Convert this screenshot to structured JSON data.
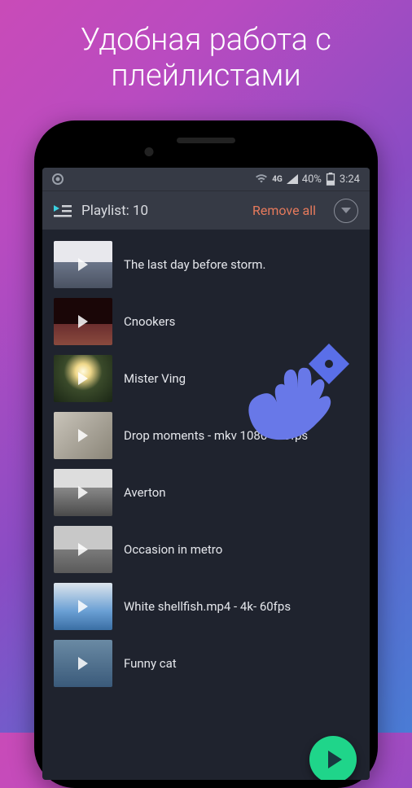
{
  "hero": {
    "title": "Удобная работа с плейлистами"
  },
  "status": {
    "battery_pct": "40%",
    "time": "3:24",
    "net": "4G"
  },
  "header": {
    "playlist_label": "Playlist:",
    "playlist_count": "10",
    "remove_all": "Remove all"
  },
  "items": [
    {
      "title": "The last day before storm."
    },
    {
      "title": "Cnookers"
    },
    {
      "title": "Mister Ving"
    },
    {
      "title": "Drop moments - mkv 1080 - 60fps"
    },
    {
      "title": "Averton"
    },
    {
      "title": "Occasion in metro"
    },
    {
      "title": "White shellfish.mp4 - 4k- 60fps"
    },
    {
      "title": "Funny cat"
    }
  ]
}
